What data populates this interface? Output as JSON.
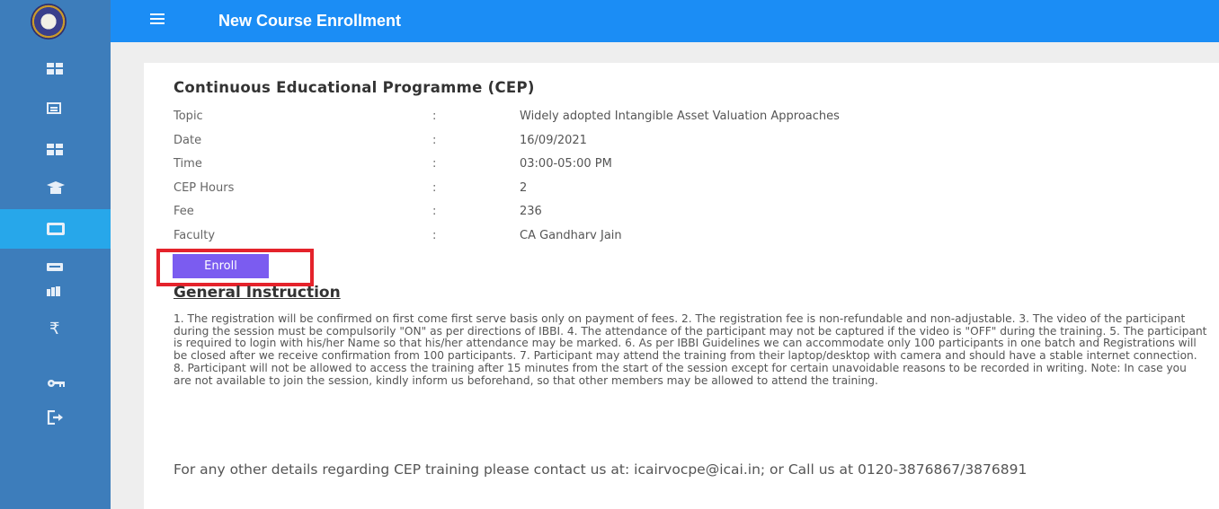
{
  "header": {
    "title": "New Course Enrollment"
  },
  "sidebar": {
    "logo": "icai-logo",
    "items": [
      {
        "icon": "dashboard-icon"
      },
      {
        "icon": "list-icon"
      },
      {
        "icon": "dashboard-icon"
      },
      {
        "icon": "graduation-cap-icon"
      },
      {
        "icon": "card-icon",
        "active": true
      },
      {
        "icon": "new-badge-icon"
      },
      {
        "icon": "books-icon"
      },
      {
        "icon": "rupee-icon",
        "glyph": "₹"
      },
      {
        "icon": "key-icon"
      },
      {
        "icon": "logout-icon"
      }
    ]
  },
  "program": {
    "title": "Continuous Educational Programme (CEP)",
    "separator": ":",
    "details": [
      {
        "label": "Topic",
        "value": "Widely adopted Intangible Asset Valuation Approaches"
      },
      {
        "label": "Date",
        "value": "16/09/2021"
      },
      {
        "label": "Time",
        "value": "03:00-05:00 PM"
      },
      {
        "label": "CEP Hours",
        "value": "2"
      },
      {
        "label": "Fee",
        "value": "236"
      },
      {
        "label": "Faculty",
        "value": "CA Gandharv Jain"
      }
    ],
    "enroll_label": "Enroll"
  },
  "instructions": {
    "title": "General Instruction",
    "body": "1. The registration will be confirmed on first come first serve basis only on payment of fees. 2. The registration fee is non-refundable and non-adjustable. 3. The video of the participant during the session must be compulsorily \"ON\" as per directions of IBBI. 4. The attendance of the participant may not be captured if the video is \"OFF\" during the training. 5. The participant is required to login with his/her Name so that his/her attendance may be marked. 6. As per IBBI Guidelines we can accommodate only 100 participants in one batch and Registrations will be closed after we receive confirmation from 100 participants. 7. Participant may attend the training from their laptop/desktop with camera and should have a stable internet connection. 8. Participant will not be allowed to access the training after 15 minutes from the start of the session except for certain unavoidable reasons to be recorded in writing. Note: In case you are not available to join the session, kindly inform us beforehand, so that other members may be allowed to attend the training.",
    "contact": "For any other details regarding CEP training please contact us at: icairvocpe@icai.in; or Call us at 0120-3876867/3876891"
  },
  "colors": {
    "sidebar": "#3d7dbb",
    "sidebar_active": "#27a7ea",
    "topbar": "#1b8df5",
    "enroll_button": "#7b5cf0",
    "highlight": "#e4232b"
  }
}
